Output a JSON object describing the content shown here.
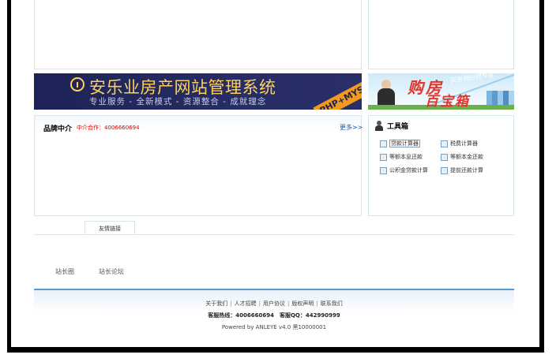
{
  "banner": {
    "title": "安乐业房产网站管理系统",
    "subtitle": "专业服务 - 全新模式 - 资源整合 - 成就理念",
    "tag": "PHP+MYSQL"
  },
  "side_banner": {
    "top_text": "买房佣份佣专家",
    "title_line1": "购房",
    "title_line2": "百宝箱"
  },
  "brand": {
    "title": "品牌中介",
    "contact": "中介合作：4006660694",
    "more": "更多>>"
  },
  "toolbox": {
    "title": "工具箱",
    "items": [
      {
        "label": "贷款计算器"
      },
      {
        "label": "税费计算器"
      },
      {
        "label": "等额本息还款"
      },
      {
        "label": "等额本金还款"
      },
      {
        "label": "公积金贷款计算"
      },
      {
        "label": "提前还款计算"
      }
    ]
  },
  "links": {
    "tab_label": "友情链接",
    "items": [
      {
        "label": "站长圈"
      },
      {
        "label": "站长论坛"
      }
    ]
  },
  "footer": {
    "links": [
      "关于我们",
      "人才招聘",
      "用户协议",
      "版权声明",
      "联系我们"
    ],
    "hotline": "客服热线：4006660694　客服QQ：442990999",
    "powered": "Powered by ANLEYE v4.0 黑10000001"
  },
  "colors": {
    "banner_bg": "#1d2356",
    "banner_title": "#ffd257",
    "accent_blue": "#5b9bd5",
    "contact_red": "#e00000",
    "panel_border": "#d6e6ee"
  }
}
